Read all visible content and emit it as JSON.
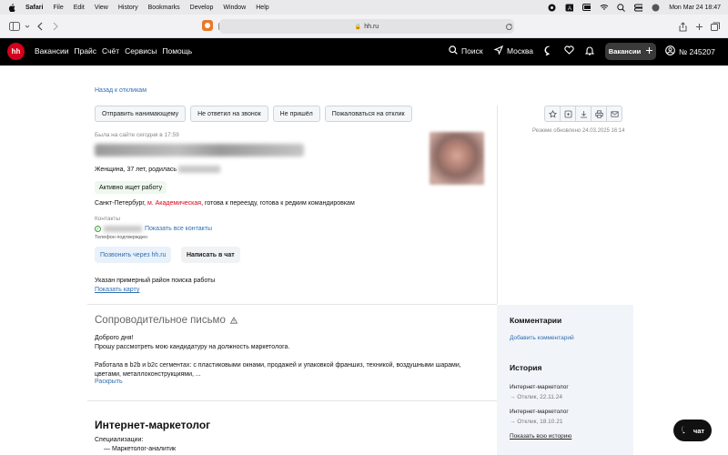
{
  "menubar": {
    "app": "Safari",
    "items": [
      "File",
      "Edit",
      "View",
      "History",
      "Bookmarks",
      "Develop",
      "Window",
      "Help"
    ],
    "datetime": "Mon Mar 24  18:47"
  },
  "browser": {
    "url": "hh.ru"
  },
  "site_header": {
    "logo": "hh",
    "nav": [
      "Вакансии",
      "Прайс",
      "Счёт",
      "Сервисы",
      "Помощь"
    ],
    "search_label": "Поиск",
    "city_label": "Москва",
    "vacancies_button": "Вакансии",
    "account_number": "№ 245207"
  },
  "resume": {
    "back_link": "Назад к откликам",
    "actions": [
      "Отправить нанимающему",
      "Не ответил на звонок",
      "Не пришёл",
      "Пожаловаться на отклик"
    ],
    "updated": "Резюме обновлено 24.03.2025 16:14",
    "last_seen": "Была на сайте сегодня в 17:59",
    "gender_age": "Женщина, 37 лет, родилась",
    "status_badge": "Активно ищет работу",
    "city": "Санкт-Петербург, ",
    "metro": "м. Академическая",
    "relocation": ", готова к переезду, готова к редким командировкам",
    "contacts_label": "Контакты",
    "show_contacts": "Показать все контакты",
    "phone_verified": "Телефон подтвержден",
    "call_button": "Позвонить через hh.ru",
    "chat_button": "Написать в чат",
    "area_text": "Указан примерный район поиска работы",
    "map_link": "Показать карту"
  },
  "cover_letter": {
    "title": "Сопроводительное письмо",
    "line1": "Доброго дня!",
    "line2": "Прошу рассмотреть мою кандидатуру на должность маркетолога.",
    "line3": "Работала в b2b и b2c сегментах: с пластиковыми окнами, продажей и упаковкой франшиз, техникой, воздушными шарами, цветами, металлоконструкциями, ...",
    "expand": "Раскрыть"
  },
  "position": {
    "title": "Интернет-маркетолог",
    "spec_label": "Специализации:",
    "spec_item": "— Маркетолог-аналитик"
  },
  "sidebar": {
    "comments_title": "Комментарии",
    "add_comment": "Добавить комментарий",
    "history_title": "История",
    "history": [
      {
        "title": "Интернет-маркетолог",
        "sub": "→ Отклик, 22.11.24"
      },
      {
        "title": "Интернет-маркетолог",
        "sub": "→ Отклик, 18.10.21"
      }
    ],
    "show_history": "Показать всю историю"
  },
  "chat_fab": "чат"
}
